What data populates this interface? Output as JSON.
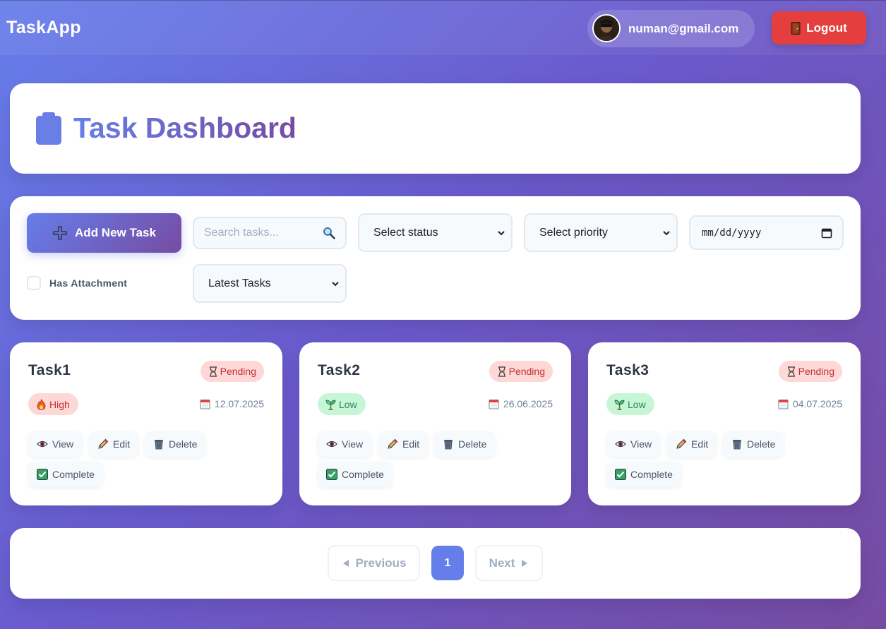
{
  "navbar": {
    "brand": "TaskApp",
    "user_email": "numan@gmail.com",
    "logout_label": "Logout",
    "logout_color": "#e53e3e"
  },
  "header": {
    "title": "Task Dashboard",
    "icon": "clipboard-icon"
  },
  "filters": {
    "add_task_label": "Add New Task",
    "search_placeholder": "Search tasks...",
    "status_value": "Select status",
    "priority_value": "Select priority",
    "date_placeholder": "mm/dd/yyyy",
    "has_attachment_label": "Has Attachment",
    "has_attachment_checked": false,
    "sort_value": "Latest Tasks"
  },
  "tasks": [
    {
      "title": "Task1",
      "status": "Pending",
      "priority": "High",
      "priority_icon": "fire-icon",
      "due_date": "12.07.2025"
    },
    {
      "title": "Task2",
      "status": "Pending",
      "priority": "Low",
      "priority_icon": "seedling-icon",
      "due_date": "26.06.2025"
    },
    {
      "title": "Task3",
      "status": "Pending",
      "priority": "Low",
      "priority_icon": "seedling-icon",
      "due_date": "04.07.2025"
    }
  ],
  "actions": {
    "view": "View",
    "edit": "Edit",
    "delete": "Delete",
    "complete": "Complete"
  },
  "pagination": {
    "previous_label": "Previous",
    "next_label": "Next",
    "current_page": "1"
  },
  "colors": {
    "accent": "#667eea",
    "accent_end": "#764ba2",
    "pending_bg": "#fed7d7",
    "low_bg": "#c6f6d5"
  }
}
